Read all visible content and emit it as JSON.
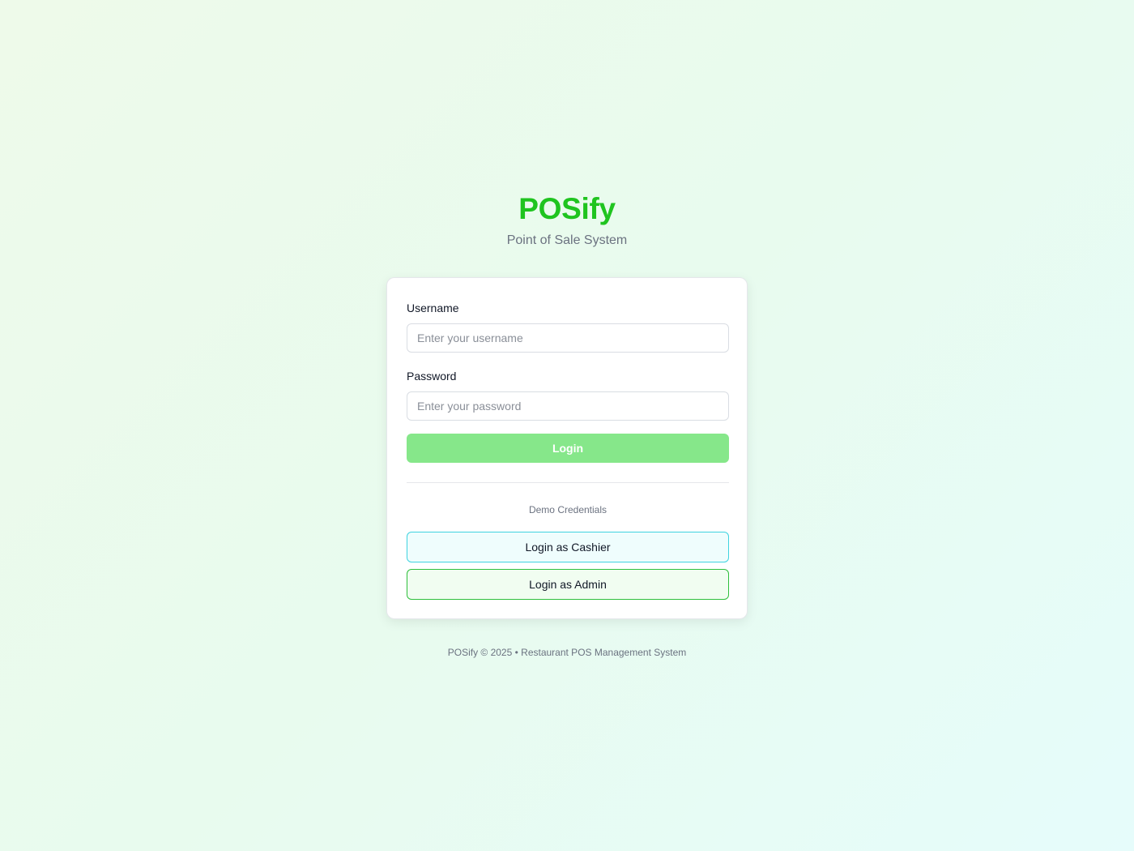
{
  "brand": {
    "title": "POSify",
    "subtitle": "Point of Sale System"
  },
  "form": {
    "username_label": "Username",
    "username_placeholder": "Enter your username",
    "username_value": "",
    "password_label": "Password",
    "password_placeholder": "Enter your password",
    "password_value": "",
    "login_label": "Login"
  },
  "demo": {
    "heading": "Demo Credentials",
    "cashier_label": "Login as Cashier",
    "admin_label": "Login as Admin"
  },
  "footer": {
    "text": "POSify © 2025 • Restaurant POS Management System"
  },
  "colors": {
    "brand": "#1fc41f",
    "login_button": "#86e78a",
    "cashier_border": "#3fd3e0",
    "admin_border": "#2fbf3c"
  }
}
